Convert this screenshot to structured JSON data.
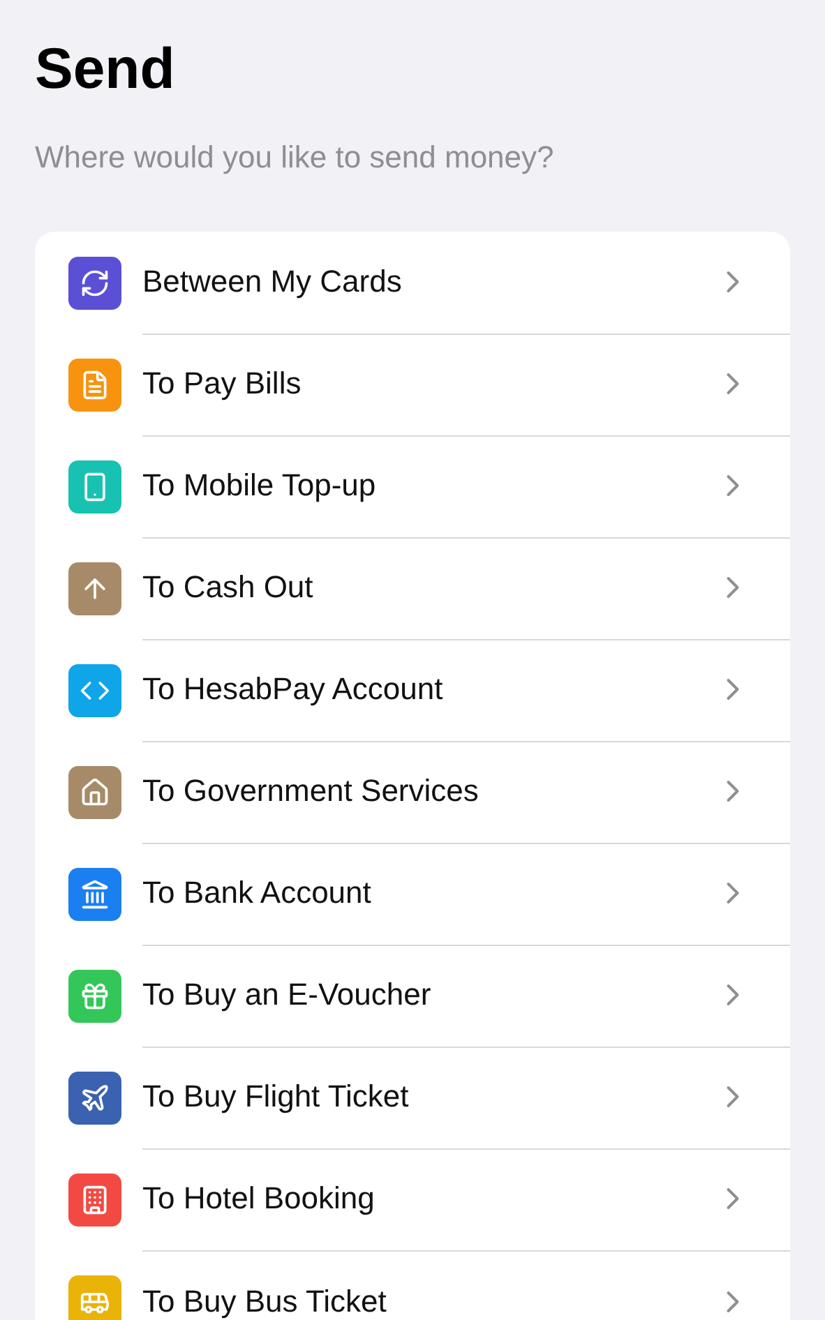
{
  "title": "Send",
  "subtitle": "Where would you like to send money?",
  "options": [
    {
      "label": "Between My Cards",
      "kind": "cards",
      "color": "#5b4fd6"
    },
    {
      "label": "To Pay Bills",
      "kind": "bills",
      "color": "#f7930f"
    },
    {
      "label": "To Mobile Top-up",
      "kind": "mobile",
      "color": "#17c2b2"
    },
    {
      "label": "To Cash Out",
      "kind": "cashout",
      "color": "#a78b68"
    },
    {
      "label": "To HesabPay Account",
      "kind": "hesabpay",
      "color": "#0ea5e9"
    },
    {
      "label": "To Government Services",
      "kind": "government",
      "color": "#a78b68"
    },
    {
      "label": "To Bank Account",
      "kind": "bank",
      "color": "#1a7ff0"
    },
    {
      "label": "To Buy an E-Voucher",
      "kind": "voucher",
      "color": "#33c75a"
    },
    {
      "label": "To Buy Flight Ticket",
      "kind": "flight",
      "color": "#3a62b0"
    },
    {
      "label": "To Hotel Booking",
      "kind": "hotel",
      "color": "#f24a43"
    },
    {
      "label": "To Buy Bus Ticket",
      "kind": "bus",
      "color": "#eab308"
    }
  ]
}
